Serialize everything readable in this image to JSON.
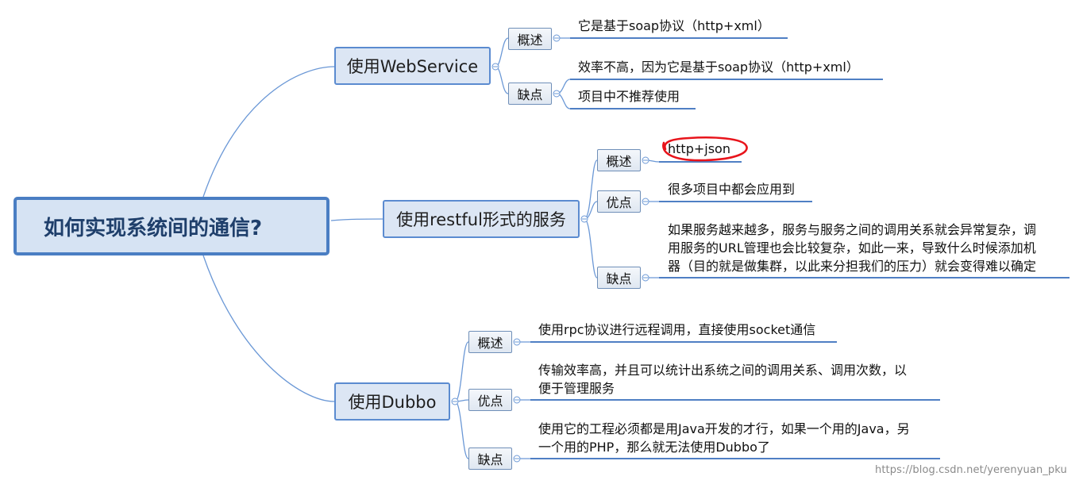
{
  "title": "如何实现系统间的通信?",
  "branches": [
    {
      "label": "使用WebService",
      "groups": [
        {
          "label": "概述",
          "items": [
            "它是基于soap协议（http+xml）"
          ]
        },
        {
          "label": "缺点",
          "items": [
            "效率不高，因为它是基于soap协议（http+xml）",
            "项目中不推荐使用"
          ]
        }
      ]
    },
    {
      "label": "使用restful形式的服务",
      "groups": [
        {
          "label": "概述",
          "items": [
            "http+json"
          ]
        },
        {
          "label": "优点",
          "items": [
            "很多项目中都会应用到"
          ]
        },
        {
          "label": "缺点",
          "items": [
            [
              "如果服务越来越多，服务与服务之间的调用关系就会异常复杂，调",
              "用服务的URL管理也会比较复杂，如此一来，导致什么时候添加机",
              "器（目的就是做集群，以此来分担我们的压力）就会变得难以确定"
            ]
          ]
        }
      ]
    },
    {
      "label": "使用Dubbo",
      "groups": [
        {
          "label": "概述",
          "items": [
            "使用rpc协议进行远程调用，直接使用socket通信"
          ]
        },
        {
          "label": "优点",
          "items": [
            [
              "传输效率高，并且可以统计出系统之间的调用关系、调用次数，以",
              "便于管理服务"
            ]
          ]
        },
        {
          "label": "缺点",
          "items": [
            [
              "使用它的工程必须都是用Java开发的才行，如果一个用的Java，另",
              "一个用的PHP，那么就无法使用Dubbo了"
            ]
          ]
        }
      ]
    }
  ],
  "watermark": "https://blog.csdn.net/yerenyuan_pku",
  "colors": {
    "line": "#5b8bd0",
    "underline": "#4f7fc4",
    "root_fill": "#d6e3f3",
    "highlight": "#e8141b"
  }
}
